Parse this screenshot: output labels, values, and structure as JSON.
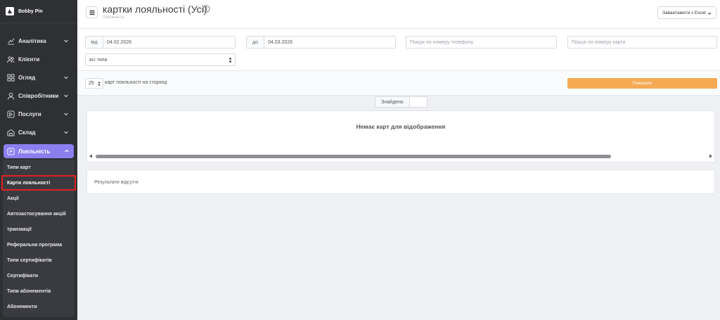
{
  "brand": {
    "name": "Bobby Pin"
  },
  "sidebar": {
    "items": [
      {
        "label": "Аналітика",
        "icon": "analytics-icon",
        "has_chevron": true
      },
      {
        "label": "Клієнти",
        "icon": "clients-icon",
        "has_chevron": false
      },
      {
        "label": "Огляд",
        "icon": "overview-icon",
        "has_chevron": true
      },
      {
        "label": "Співробітники",
        "icon": "user-icon",
        "has_chevron": true
      },
      {
        "label": "Послуги",
        "icon": "services-icon",
        "has_chevron": true
      },
      {
        "label": "Склад",
        "icon": "warehouse-icon",
        "has_chevron": true
      }
    ],
    "active": {
      "label": "Лояльність",
      "icon": "loyalty-icon"
    },
    "subitems": [
      {
        "label": "Типи карт",
        "selected": false
      },
      {
        "label": "Карти лояльності",
        "selected": true
      },
      {
        "label": "Акції",
        "selected": false
      },
      {
        "label": "Автозастосування акцій",
        "selected": false
      },
      {
        "label": "транзакції",
        "selected": false
      },
      {
        "label": "Реферальна програма",
        "selected": false
      },
      {
        "label": "Типи сертифікатів",
        "selected": false
      },
      {
        "label": "Сертифікати",
        "selected": false
      },
      {
        "label": "Типи абонементів",
        "selected": false
      },
      {
        "label": "Абонементи",
        "selected": false
      }
    ]
  },
  "header": {
    "title": "картки лояльності (Усі)",
    "breadcrumb": "Лояльність",
    "export_label": "Завантажити з Excel"
  },
  "filters": {
    "from_label": "від",
    "from_value": "04.02.2026",
    "to_label": "до",
    "to_value": "04.03.2026",
    "phone_placeholder": "Пошук по номеру телефону",
    "card_placeholder": "Пошук по номеру карти",
    "type_value": "всі типи"
  },
  "pagination": {
    "per_page": "25",
    "per_page_label": "карт лояльності на сторінці",
    "show_label": "Показати"
  },
  "found": {
    "label": "Знайдено",
    "count": ""
  },
  "table": {
    "empty_message": "Немає карт для відображення"
  },
  "results": {
    "message": "Результати відсутні"
  },
  "colors": {
    "accent": "#8b7ff0",
    "button": "#f6aa54",
    "sidebar": "#2f3034",
    "highlight": "#e02020"
  }
}
